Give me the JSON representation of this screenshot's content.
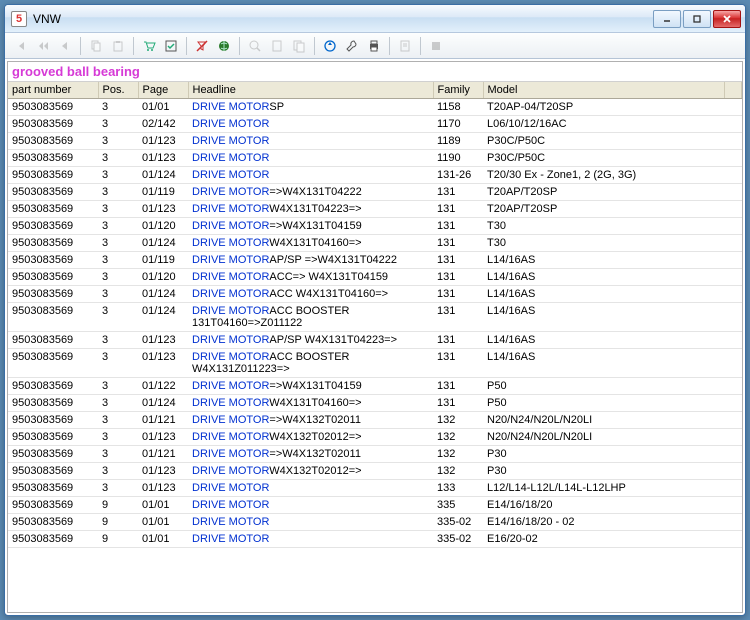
{
  "window": {
    "title": "VNW"
  },
  "heading": "grooved ball bearing",
  "columns": {
    "part_number": "part number",
    "pos": "Pos.",
    "page": "Page",
    "headline": "Headline",
    "family": "Family",
    "model": "Model"
  },
  "rows": [
    {
      "pn": "9503083569",
      "pos": "3",
      "page": "01/01",
      "link": "DRIVE MOTOR",
      "suffix": "SP",
      "fam": "1158",
      "model": "T20AP-04/T20SP"
    },
    {
      "pn": "9503083569",
      "pos": "3",
      "page": "02/142",
      "link": "DRIVE MOTOR",
      "suffix": "",
      "fam": "1170",
      "model": "L06/10/12/16AC"
    },
    {
      "pn": "9503083569",
      "pos": "3",
      "page": "01/123",
      "link": "DRIVE MOTOR",
      "suffix": "",
      "fam": "1189",
      "model": "P30C/P50C"
    },
    {
      "pn": "9503083569",
      "pos": "3",
      "page": "01/123",
      "link": "DRIVE MOTOR",
      "suffix": "",
      "fam": "1190",
      "model": "P30C/P50C"
    },
    {
      "pn": "9503083569",
      "pos": "3",
      "page": "01/124",
      "link": "DRIVE MOTOR",
      "suffix": "",
      "fam": "131-26",
      "model": "T20/30 Ex - Zone1, 2 (2G, 3G)"
    },
    {
      "pn": "9503083569",
      "pos": "3",
      "page": "01/119",
      "link": "DRIVE MOTOR",
      "suffix": "=>W4X131T04222",
      "fam": "131",
      "model": "T20AP/T20SP"
    },
    {
      "pn": "9503083569",
      "pos": "3",
      "page": "01/123",
      "link": "DRIVE MOTOR",
      "suffix": "W4X131T04223=>",
      "fam": "131",
      "model": "T20AP/T20SP"
    },
    {
      "pn": "9503083569",
      "pos": "3",
      "page": "01/120",
      "link": "DRIVE MOTOR",
      "suffix": "=>W4X131T04159",
      "fam": "131",
      "model": "T30"
    },
    {
      "pn": "9503083569",
      "pos": "3",
      "page": "01/124",
      "link": "DRIVE MOTOR",
      "suffix": "W4X131T04160=>",
      "fam": "131",
      "model": "T30"
    },
    {
      "pn": "9503083569",
      "pos": "3",
      "page": "01/119",
      "link": "DRIVE MOTOR",
      "suffix": "AP/SP =>W4X131T04222",
      "fam": "131",
      "model": "L14/16AS"
    },
    {
      "pn": "9503083569",
      "pos": "3",
      "page": "01/120",
      "link": "DRIVE MOTOR",
      "suffix": "ACC=> W4X131T04159",
      "fam": "131",
      "model": "L14/16AS"
    },
    {
      "pn": "9503083569",
      "pos": "3",
      "page": "01/124",
      "link": "DRIVE MOTOR",
      "suffix": "ACC  W4X131T04160=>",
      "fam": "131",
      "model": "L14/16AS"
    },
    {
      "pn": "9503083569",
      "pos": "3",
      "page": "01/124",
      "link": "DRIVE MOTOR",
      "suffix": "ACC BOOSTER 131T04160=>Z011122",
      "fam": "131",
      "model": "L14/16AS"
    },
    {
      "pn": "9503083569",
      "pos": "3",
      "page": "01/123",
      "link": "DRIVE MOTOR",
      "suffix": "AP/SP W4X131T04223=>",
      "fam": "131",
      "model": "L14/16AS"
    },
    {
      "pn": "9503083569",
      "pos": "3",
      "page": "01/123",
      "link": "DRIVE MOTOR",
      "suffix": "ACC BOOSTER W4X131Z011223=>",
      "fam": "131",
      "model": "L14/16AS"
    },
    {
      "pn": "9503083569",
      "pos": "3",
      "page": "01/122",
      "link": "DRIVE MOTOR",
      "suffix": "=>W4X131T04159",
      "fam": "131",
      "model": "P50"
    },
    {
      "pn": "9503083569",
      "pos": "3",
      "page": "01/124",
      "link": "DRIVE MOTOR",
      "suffix": "W4X131T04160=>",
      "fam": "131",
      "model": "P50"
    },
    {
      "pn": "9503083569",
      "pos": "3",
      "page": "01/121",
      "link": "DRIVE MOTOR",
      "suffix": "=>W4X132T02011",
      "fam": "132",
      "model": "N20/N24/N20L/N20LI"
    },
    {
      "pn": "9503083569",
      "pos": "3",
      "page": "01/123",
      "link": "DRIVE MOTOR",
      "suffix": "W4X132T02012=>",
      "fam": "132",
      "model": "N20/N24/N20L/N20LI"
    },
    {
      "pn": "9503083569",
      "pos": "3",
      "page": "01/121",
      "link": "DRIVE MOTOR",
      "suffix": "=>W4X132T02011",
      "fam": "132",
      "model": "P30"
    },
    {
      "pn": "9503083569",
      "pos": "3",
      "page": "01/123",
      "link": "DRIVE MOTOR",
      "suffix": "W4X132T02012=>",
      "fam": "132",
      "model": "P30"
    },
    {
      "pn": "9503083569",
      "pos": "3",
      "page": "01/123",
      "link": "DRIVE MOTOR",
      "suffix": "",
      "fam": "133",
      "model": "L12/L14-L12L/L14L-L12LHP"
    },
    {
      "pn": "9503083569",
      "pos": "9",
      "page": "01/01",
      "link": "DRIVE MOTOR",
      "suffix": "",
      "fam": "335",
      "model": "E14/16/18/20"
    },
    {
      "pn": "9503083569",
      "pos": "9",
      "page": "01/01",
      "link": "DRIVE MOTOR",
      "suffix": "",
      "fam": "335-02",
      "model": "E14/16/18/20 - 02"
    },
    {
      "pn": "9503083569",
      "pos": "9",
      "page": "01/01",
      "link": "DRIVE MOTOR",
      "suffix": "",
      "fam": "335-02",
      "model": "E16/20-02"
    }
  ]
}
